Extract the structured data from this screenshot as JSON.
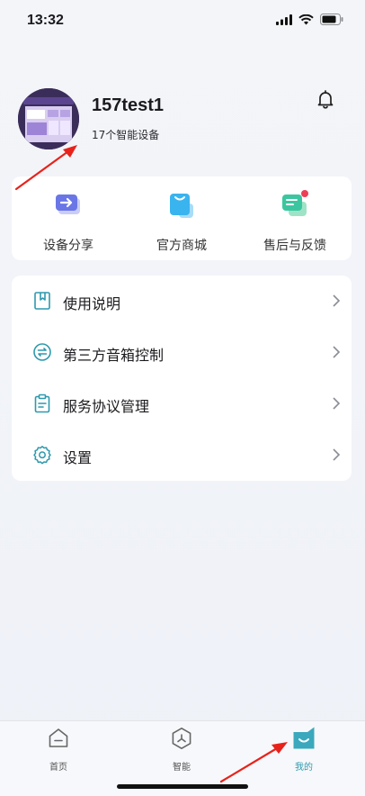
{
  "status": {
    "time": "13:32"
  },
  "profile": {
    "name": "157test1",
    "device_count": "17个智能设备"
  },
  "quick_actions": [
    {
      "label": "设备分享",
      "icon": "share-arrow-icon"
    },
    {
      "label": "官方商城",
      "icon": "shopping-bag-icon"
    },
    {
      "label": "售后与反馈",
      "icon": "feedback-chat-icon"
    }
  ],
  "menu": [
    {
      "label": "使用说明",
      "icon": "manual-book-icon"
    },
    {
      "label": "第三方音箱控制",
      "icon": "exchange-icon"
    },
    {
      "label": "服务协议管理",
      "icon": "clipboard-icon"
    },
    {
      "label": "设置",
      "icon": "gear-icon"
    }
  ],
  "tabbar": [
    {
      "label": "首页",
      "icon": "home-icon"
    },
    {
      "label": "智能",
      "icon": "smart-hexagon-icon"
    },
    {
      "label": "我的",
      "icon": "profile-face-icon",
      "active": true
    }
  ],
  "colors": {
    "accent": "#2e99ad",
    "annotation_arrow": "#e8221b",
    "feedback_dot": "#ec4057"
  }
}
